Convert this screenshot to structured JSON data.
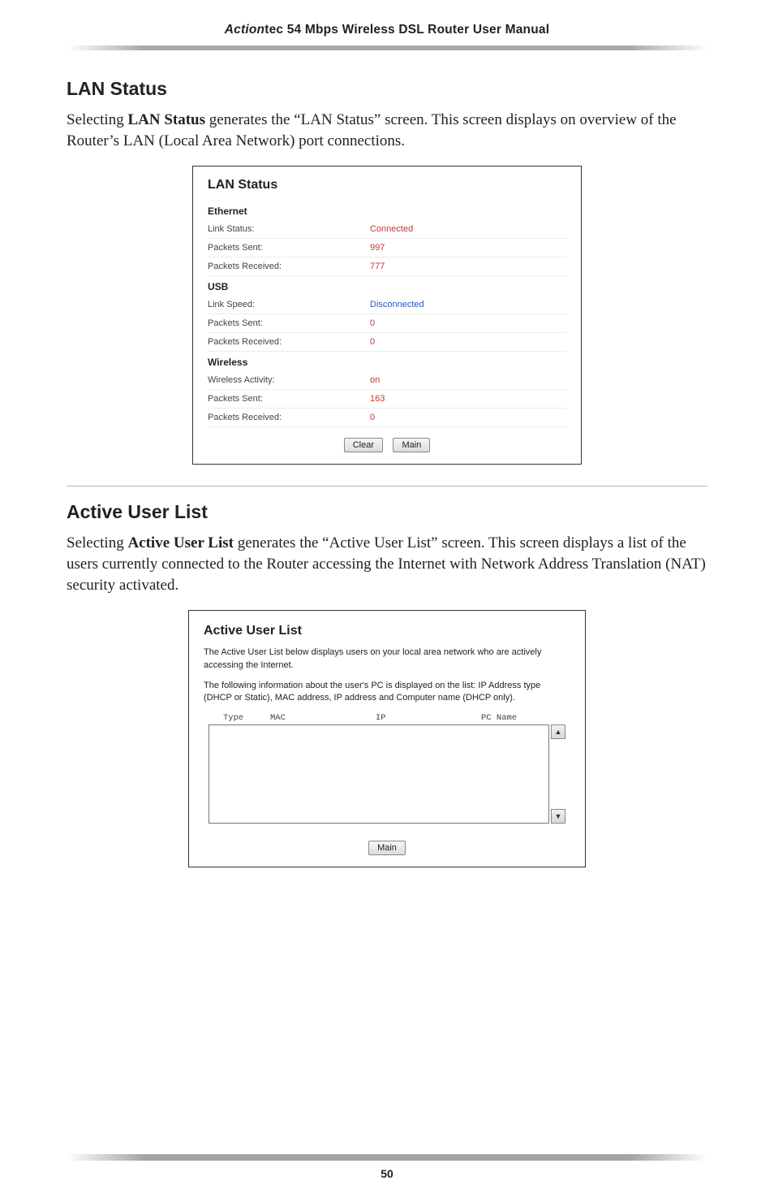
{
  "header": {
    "brand_bold": "Action",
    "brand_rest": "tec 54 Mbps Wireless DSL Router User Manual"
  },
  "page_number": "50",
  "section_lan": {
    "heading": "LAN Status",
    "body_pre": "Selecting ",
    "body_strong": "LAN Status",
    "body_mid1": " generates the “",
    "body_sc1": "LAN",
    "body_mid2": " Status” screen. This screen displays on overview of the Router’s ",
    "body_sc2": "LAN",
    "body_post": " (Local Area Network) port connections."
  },
  "panel_lan": {
    "title": "LAN Status",
    "groups": {
      "ethernet": {
        "label": "Ethernet",
        "link_status_k": "Link Status:",
        "link_status_v": "Connected",
        "pkts_sent_k": "Packets Sent:",
        "pkts_sent_v": "997",
        "pkts_recv_k": "Packets Received:",
        "pkts_recv_v": "777"
      },
      "usb": {
        "label": "USB",
        "link_speed_k": "Link Speed:",
        "link_speed_v": "Disconnected",
        "pkts_sent_k": "Packets Sent:",
        "pkts_sent_v": "0",
        "pkts_recv_k": "Packets Received:",
        "pkts_recv_v": "0"
      },
      "wireless": {
        "label": "Wireless",
        "activity_k": "Wireless Activity:",
        "activity_v": "on",
        "pkts_sent_k": "Packets Sent:",
        "pkts_sent_v": "163",
        "pkts_recv_k": "Packets Received:",
        "pkts_recv_v": "0"
      }
    },
    "buttons": {
      "clear": "Clear",
      "main": "Main"
    }
  },
  "section_aul": {
    "heading": "Active User List",
    "body_pre": "Selecting ",
    "body_strong": "Active User List",
    "body_mid1": " generates the “Active User List” screen. This screen displays a list of the users currently connected to the Router accessing the Internet with Network Address Translation (",
    "body_sc": "NAT",
    "body_post": ") security activated."
  },
  "panel_aul": {
    "title": "Active User List",
    "desc1": "The Active User List below displays users on your local area network who are actively accessing the Internet.",
    "desc2": "The following information about the user's PC is displayed on the list: IP Address type (DHCP or Static), MAC address, IP address and Computer name (DHCP only).",
    "cols": {
      "type": "Type",
      "mac": "MAC",
      "ip": "IP",
      "pc": "PC Name"
    },
    "rows": [],
    "buttons": {
      "main": "Main"
    },
    "scroll": {
      "up": "▲",
      "down": "▼"
    }
  }
}
